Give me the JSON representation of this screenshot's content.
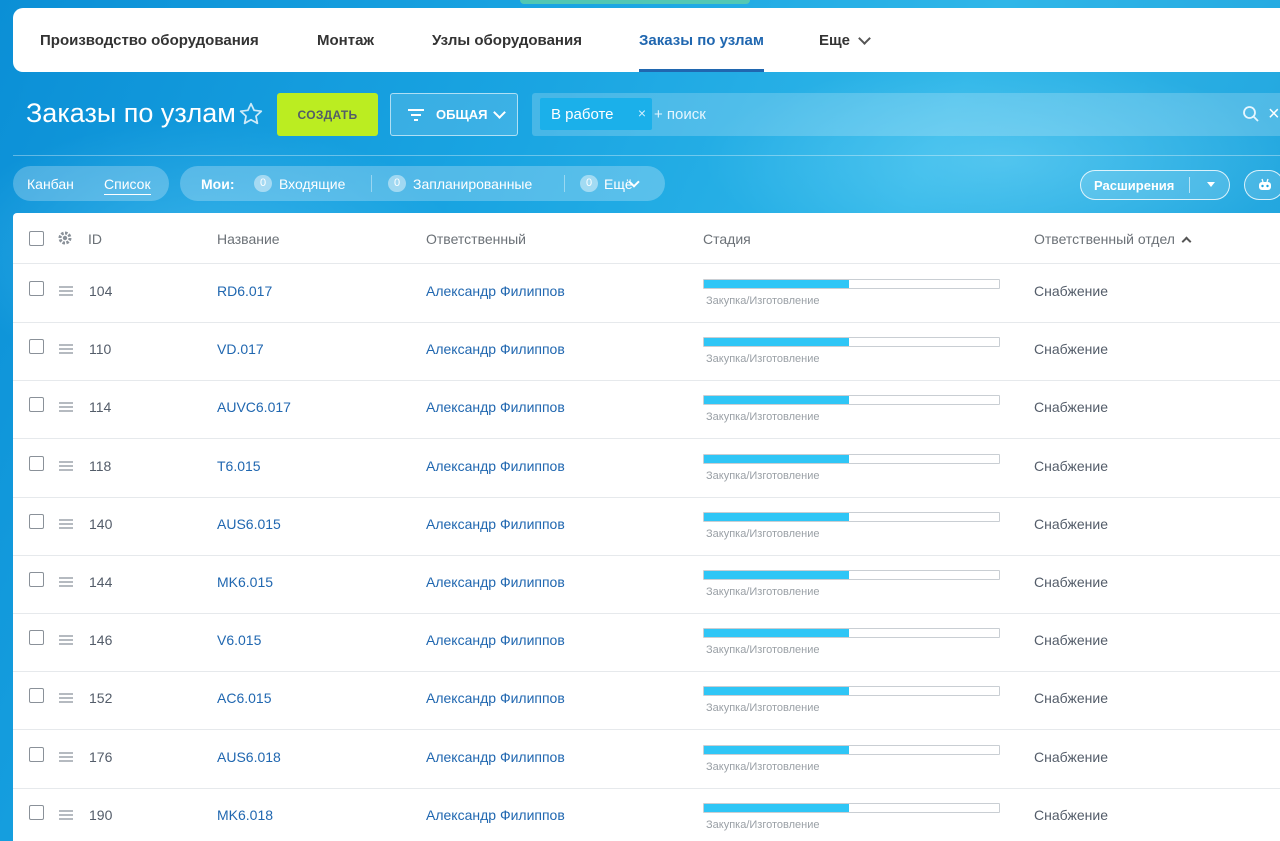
{
  "colors": {
    "accent": "#2067b0",
    "create_button": "#bbed21",
    "stage_fill": "#2fc6f6",
    "chip": "#1bb0ea"
  },
  "topnav": {
    "items": [
      {
        "label": "Производство оборудования"
      },
      {
        "label": "Монтаж"
      },
      {
        "label": "Узлы оборудования"
      },
      {
        "label": "Заказы по узлам",
        "active": true
      },
      {
        "label": "Еще"
      }
    ]
  },
  "header": {
    "title": "Заказы по узлам",
    "create_label": "СОЗДАТЬ",
    "filter_label": "ОБЩАЯ"
  },
  "search": {
    "chip_label": "В работе",
    "chip_close": "×",
    "placeholder": "+ поиск",
    "close": "×"
  },
  "views": {
    "kanban": "Канбан",
    "list": "Список",
    "active": "list"
  },
  "counters": {
    "my_label": "Мои:",
    "incoming": {
      "count": "0",
      "label": "Входящие"
    },
    "planned": {
      "count": "0",
      "label": "Запланированные"
    },
    "more": {
      "count": "0",
      "label": "Ещё"
    }
  },
  "extensions_label": "Расширения",
  "table": {
    "columns": {
      "id": "ID",
      "name": "Название",
      "responsible": "Ответственный",
      "stage": "Стадия",
      "department": "Ответственный отдел"
    },
    "rows": [
      {
        "id": "104",
        "name": "RD6.017",
        "responsible": "Александр Филиппов",
        "stage": "Закупка/Изготовление",
        "stage_progress": 0.49,
        "department": "Снабжение"
      },
      {
        "id": "110",
        "name": "VD.017",
        "responsible": "Александр Филиппов",
        "stage": "Закупка/Изготовление",
        "stage_progress": 0.49,
        "department": "Снабжение"
      },
      {
        "id": "114",
        "name": "AUVC6.017",
        "responsible": "Александр Филиппов",
        "stage": "Закупка/Изготовление",
        "stage_progress": 0.49,
        "department": "Снабжение"
      },
      {
        "id": "118",
        "name": "T6.015",
        "responsible": "Александр Филиппов",
        "stage": "Закупка/Изготовление",
        "stage_progress": 0.49,
        "department": "Снабжение"
      },
      {
        "id": "140",
        "name": "AUS6.015",
        "responsible": "Александр Филиппов",
        "stage": "Закупка/Изготовление",
        "stage_progress": 0.49,
        "department": "Снабжение"
      },
      {
        "id": "144",
        "name": "MK6.015",
        "responsible": "Александр Филиппов",
        "stage": "Закупка/Изготовление",
        "stage_progress": 0.49,
        "department": "Снабжение"
      },
      {
        "id": "146",
        "name": "V6.015",
        "responsible": "Александр Филиппов",
        "stage": "Закупка/Изготовление",
        "stage_progress": 0.49,
        "department": "Снабжение"
      },
      {
        "id": "152",
        "name": "AC6.015",
        "responsible": "Александр Филиппов",
        "stage": "Закупка/Изготовление",
        "stage_progress": 0.49,
        "department": "Снабжение"
      },
      {
        "id": "176",
        "name": "AUS6.018",
        "responsible": "Александр Филиппов",
        "stage": "Закупка/Изготовление",
        "stage_progress": 0.49,
        "department": "Снабжение"
      },
      {
        "id": "190",
        "name": "MK6.018",
        "responsible": "Александр Филиппов",
        "stage": "Закупка/Изготовление",
        "stage_progress": 0.49,
        "department": "Снабжение"
      }
    ]
  }
}
